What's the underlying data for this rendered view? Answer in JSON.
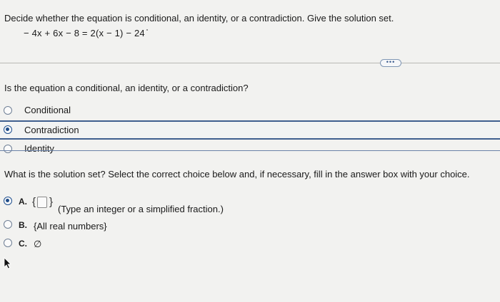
{
  "instruction": "Decide whether the equation is conditional, an identity, or a contradiction. Give the solution set.",
  "equation": "− 4x + 6x − 8 = 2(x − 1) − 24",
  "more_button": "•••",
  "question1": "Is the equation a conditional, an identity, or a contradiction?",
  "options1": [
    {
      "label": "Conditional",
      "selected": false
    },
    {
      "label": "Contradiction",
      "selected": true
    },
    {
      "label": "Identity",
      "selected": false
    }
  ],
  "question2": "What is the solution set? Select the correct choice below and, if necessary, fill in the answer box with your choice.",
  "choices2": {
    "a": {
      "letter": "A.",
      "brace_open": "{",
      "brace_close": "}",
      "text": "(Type an integer or a simplified fraction.)",
      "selected": true,
      "answer_value": ""
    },
    "b": {
      "letter": "B.",
      "text": "{All real numbers}",
      "selected": false
    },
    "c": {
      "letter": "C.",
      "text": "∅",
      "selected": false
    }
  },
  "colors": {
    "accent": "#1e4c89",
    "selected_row_border": "#3f5f8f",
    "background": "#f2f2f0"
  }
}
